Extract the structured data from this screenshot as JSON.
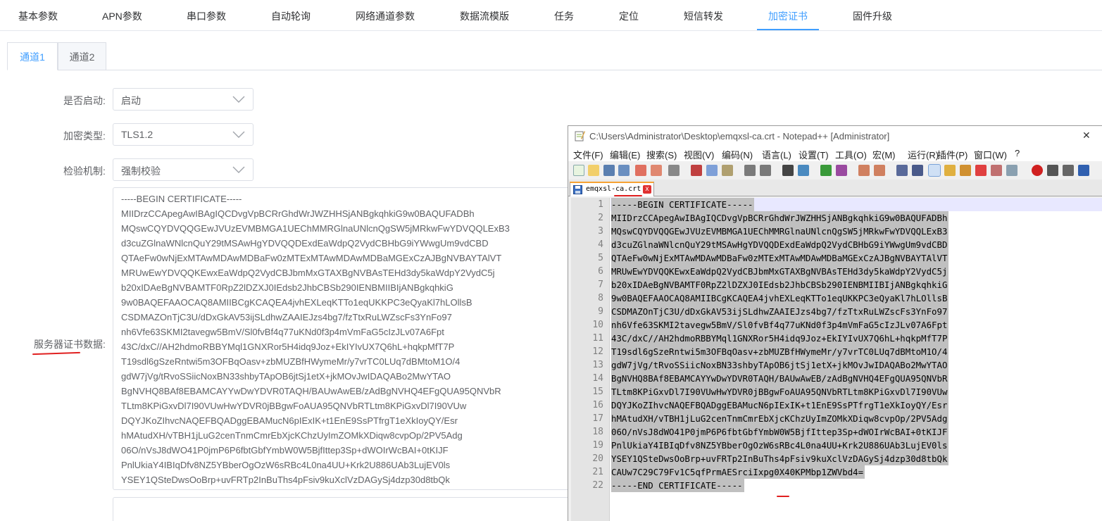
{
  "top_tabs": [
    "基本参数",
    "APN参数",
    "串口参数",
    "自动轮询",
    "网络通道参数",
    "数据流模版",
    "任务",
    "定位",
    "短信转发",
    "加密证书",
    "固件升级"
  ],
  "active_top_tab": "加密证书",
  "channel_tabs": [
    "通道1",
    "通道2"
  ],
  "form": {
    "enable_label": "是否启动:",
    "enable_value": "启动",
    "encrypt_label": "加密类型:",
    "encrypt_value": "TLS1.2",
    "verify_label": "检验机制:",
    "verify_value": "强制校验",
    "server_cert_label": "服务器证书数据:"
  },
  "cert_textarea_lines": [
    "-----BEGIN CERTIFICATE-----",
    "MIIDrzCCApegAwIBAgIQCDvgVpBCRrGhdWrJWZHHSjANBgkqhkiG9w0BAQUFADBh",
    "MQswCQYDVQQGEwJVUzEVMBMGA1UEChMMRGlnaUNlcnQgSW5jMRkwFwYDVQQLExB3",
    "d3cuZGlnaWNlcnQuY29tMSAwHgYDVQQDExdEaWdpQ2VydCBHbG9iYWwgUm9vdCBD",
    "QTAeFw0wNjExMTAwMDAwMDBaFw0zMTExMTAwMDAwMDBaMGExCzAJBgNVBAYTAlVT",
    "MRUwEwYDVQQKEwxEaWdpQ2VydCBJbmMxGTAXBgNVBAsTEHd3dy5kaWdpY2VydC5j",
    "b20xIDAeBgNVBAMTF0RpZ2lDZXJ0IEdsb2JhbCBSb290IENBMIIBIjANBgkqhkiG",
    "9w0BAQEFAAOCAQ8AMIIBCgKCAQEA4jvhEXLeqKTTo1eqUKKPC3eQyaKl7hLOllsB",
    "CSDMAZOnTjC3U/dDxGkAV53ijSLdhwZAAIEJzs4bg7/fzTtxRuLWZscFs3YnFo97",
    "nh6Vfe63SKMI2tavegw5BmV/Sl0fvBf4q77uKNd0f3p4mVmFaG5cIzJLv07A6Fpt",
    "43C/dxC//AH2hdmoRBBYMql1GNXRor5H4idq9Joz+EkIYIvUX7Q6hL+hqkpMfT7P",
    "T19sdl6gSzeRntwi5m3OFBqOasv+zbMUZBfHWymeMr/y7vrTC0LUq7dBMtoM1O/4",
    "gdW7jVg/tRvoSSiicNoxBN33shbyTApOB6jtSj1etX+jkMOvJwIDAQABo2MwYTAO",
    "BgNVHQ8BAf8EBAMCAYYwDwYDVR0TAQH/BAUwAwEB/zAdBgNVHQ4EFgQUA95QNVbR",
    "TLtm8KPiGxvDl7I90VUwHwYDVR0jBBgwFoAUA95QNVbRTLtm8KPiGxvDl7I90VUw",
    "DQYJKoZIhvcNAQEFBQADggEBAMucN6pIExIK+t1EnE9SsPTfrgT1eXkIoyQY/Esr",
    "hMAtudXH/vTBH1jLuG2cenTnmCmrEbXjcKChzUyImZOMkXDiqw8cvpOp/2PV5Adg",
    "06O/nVsJ8dWO41P0jmP6P6fbtGbfYmbW0W5BjfIttep3Sp+dWOIrWcBAI+0tKIJF",
    "PnlUkiaY4IBIqDfv8NZ5YBberOgOzW6sRBc4L0na4UU+Krk2U886UAb3LujEV0ls",
    "YSEY1QSteDwsOoBrp+uvFRTp2InBuThs4pFsiv9kuXclVzDAGySj4dzp30d8tbQk"
  ],
  "npp": {
    "title": "C:\\Users\\Administrator\\Desktop\\emqxsl-ca.crt - Notepad++ [Administrator]",
    "close_glyph": "✕",
    "menu": [
      "文件(F)",
      "编辑(E)",
      "搜索(S)",
      "视图(V)",
      "编码(N)",
      "语言(L)",
      "设置(T)",
      "工具(O)",
      "宏(M)",
      "运行(R)",
      "插件(P)",
      "窗口(W)",
      "?"
    ],
    "tab_label": "emqxsl-ca.crt",
    "tab_close_glyph": "x",
    "lines": [
      "-----BEGIN CERTIFICATE-----",
      "MIIDrzCCApegAwIBAgIQCDvgVpBCRrGhdWrJWZHHSjANBgkqhkiG9w0BAQUFADBh",
      "MQswCQYDVQQGEwJVUzEVMBMGA1UEChMMRGlnaUNlcnQgSW5jMRkwFwYDVQQLExB3",
      "d3cuZGlnaWNlcnQuY29tMSAwHgYDVQQDExdEaWdpQ2VydCBHbG9iYWwgUm9vdCBD",
      "QTAeFw0wNjExMTAwMDAwMDBaFw0zMTExMTAwMDAwMDBaMGExCzAJBgNVBAYTAlVT",
      "MRUwEwYDVQQKEwxEaWdpQ2VydCBJbmMxGTAXBgNVBAsTEHd3dy5kaWdpY2VydC5j",
      "b20xIDAeBgNVBAMTF0RpZ2lDZXJ0IEdsb2JhbCBSb290IENBMIIBIjANBgkqhkiG",
      "9w0BAQEFAAOCAQ8AMIIBCgKCAQEA4jvhEXLeqKTTo1eqUKKPC3eQyaKl7hLOllsB",
      "CSDMAZOnTjC3U/dDxGkAV53ijSLdhwZAAIEJzs4bg7/fzTtxRuLWZscFs3YnFo97",
      "nh6Vfe63SKMI2tavegw5BmV/Sl0fvBf4q77uKNd0f3p4mVmFaG5cIzJLv07A6Fpt",
      "43C/dxC//AH2hdmoRBBYMql1GNXRor5H4idq9Joz+EkIYIvUX7Q6hL+hqkpMfT7P",
      "T19sdl6gSzeRntwi5m3OFBqOasv+zbMUZBfHWymeMr/y7vrTC0LUq7dBMtoM1O/4",
      "gdW7jVg/tRvoSSiicNoxBN33shbyTApOB6jtSj1etX+jkMOvJwIDAQABo2MwYTAO",
      "BgNVHQ8BAf8EBAMCAYYwDwYDVR0TAQH/BAUwAwEB/zAdBgNVHQ4EFgQUA95QNVbR",
      "TLtm8KPiGxvDl7I90VUwHwYDVR0jBBgwFoAUA95QNVbRTLtm8KPiGxvDl7I90VUw",
      "DQYJKoZIhvcNAQEFBQADggEBAMucN6pIExIK+t1EnE9SsPTfrgT1eXkIoyQY/Esr",
      "hMAtudXH/vTBH1jLuG2cenTnmCmrEbXjcKChzUyImZOMkXDiqw8cvpOp/2PV5Adg",
      "06O/nVsJ8dWO41P0jmP6P6fbtGbfYmbW0W5BjfIttep3Sp+dWOIrWcBAI+0tKIJF",
      "PnlUkiaY4IBIqDfv8NZ5YBberOgOzW6sRBc4L0na4UU+Krk2U886UAb3LujEV0ls",
      "YSEY1QSteDwsOoBrp+uvFRTp2InBuThs4pFsiv9kuXclVzDAGySj4dzp30d8tbQk",
      "CAUw7C29C79Fv1C5qfPrmAESrciIxpg0X40KPMbp1ZWVbd4=",
      "-----END CERTIFICATE-----"
    ]
  },
  "colors": {
    "accent": "#409eff",
    "annotation_red": "#e02020",
    "selection": "#c0c0c0"
  }
}
